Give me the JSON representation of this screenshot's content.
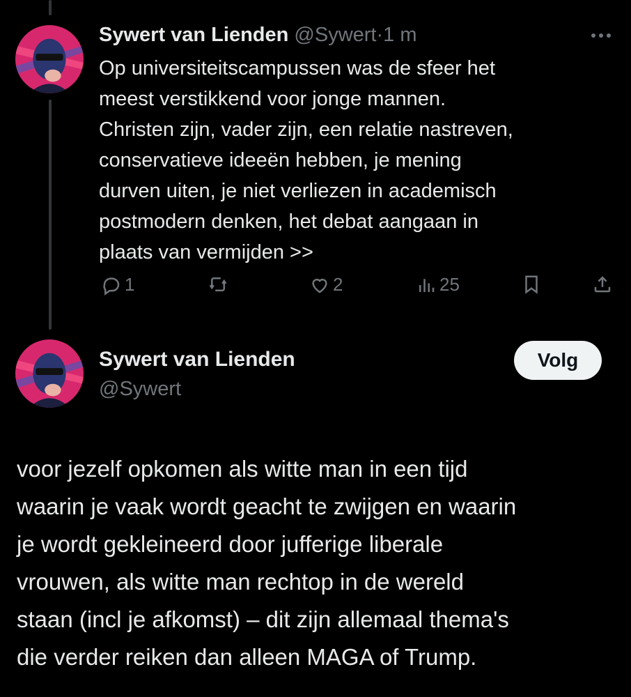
{
  "reply_tweet": {
    "author_name": "Sywert van Lienden",
    "author_handle": "@Sywert",
    "separator": "·",
    "time": "1 m",
    "text": "Op universiteitscampussen was de sfeer het\nmeest verstikkend voor jonge mannen.\nChristen zijn, vader zijn, een relatie nastreven,\nconservatieve ideeën hebben, je mening\ndurven uiten, je niet verliezen in academisch\npostmodern denken, het debat aangaan in\nplaats van vermijden >>",
    "stats": {
      "replies": "1",
      "retweets": "",
      "likes": "2",
      "views": "25"
    },
    "icons": [
      "reply-icon",
      "retweet-icon",
      "like-icon",
      "views-icon",
      "bookmark-icon",
      "share-icon",
      "more-icon"
    ]
  },
  "main_tweet": {
    "author_name": "Sywert van Lienden",
    "author_handle": "@Sywert",
    "follow_label": "Volg",
    "text": "voor jezelf opkomen als witte man in een tijd\nwaarin je vaak wordt geacht te zwijgen en waarin\nje wordt gekleineerd door jufferige liberale\nvrouwen, als witte man rechtop in de wereld\nstaan (incl je afkomst) – dit zijn allemaal thema's\ndie verder reiken dan alleen MAGA of Trump."
  },
  "colors": {
    "background": "#000000",
    "text_primary": "#e7e9ea",
    "text_secondary": "#71767b",
    "thread_line": "#333639",
    "follow_bg": "#eff3f4",
    "follow_text": "#0f1419",
    "avatar_bg": "#d7286e"
  }
}
